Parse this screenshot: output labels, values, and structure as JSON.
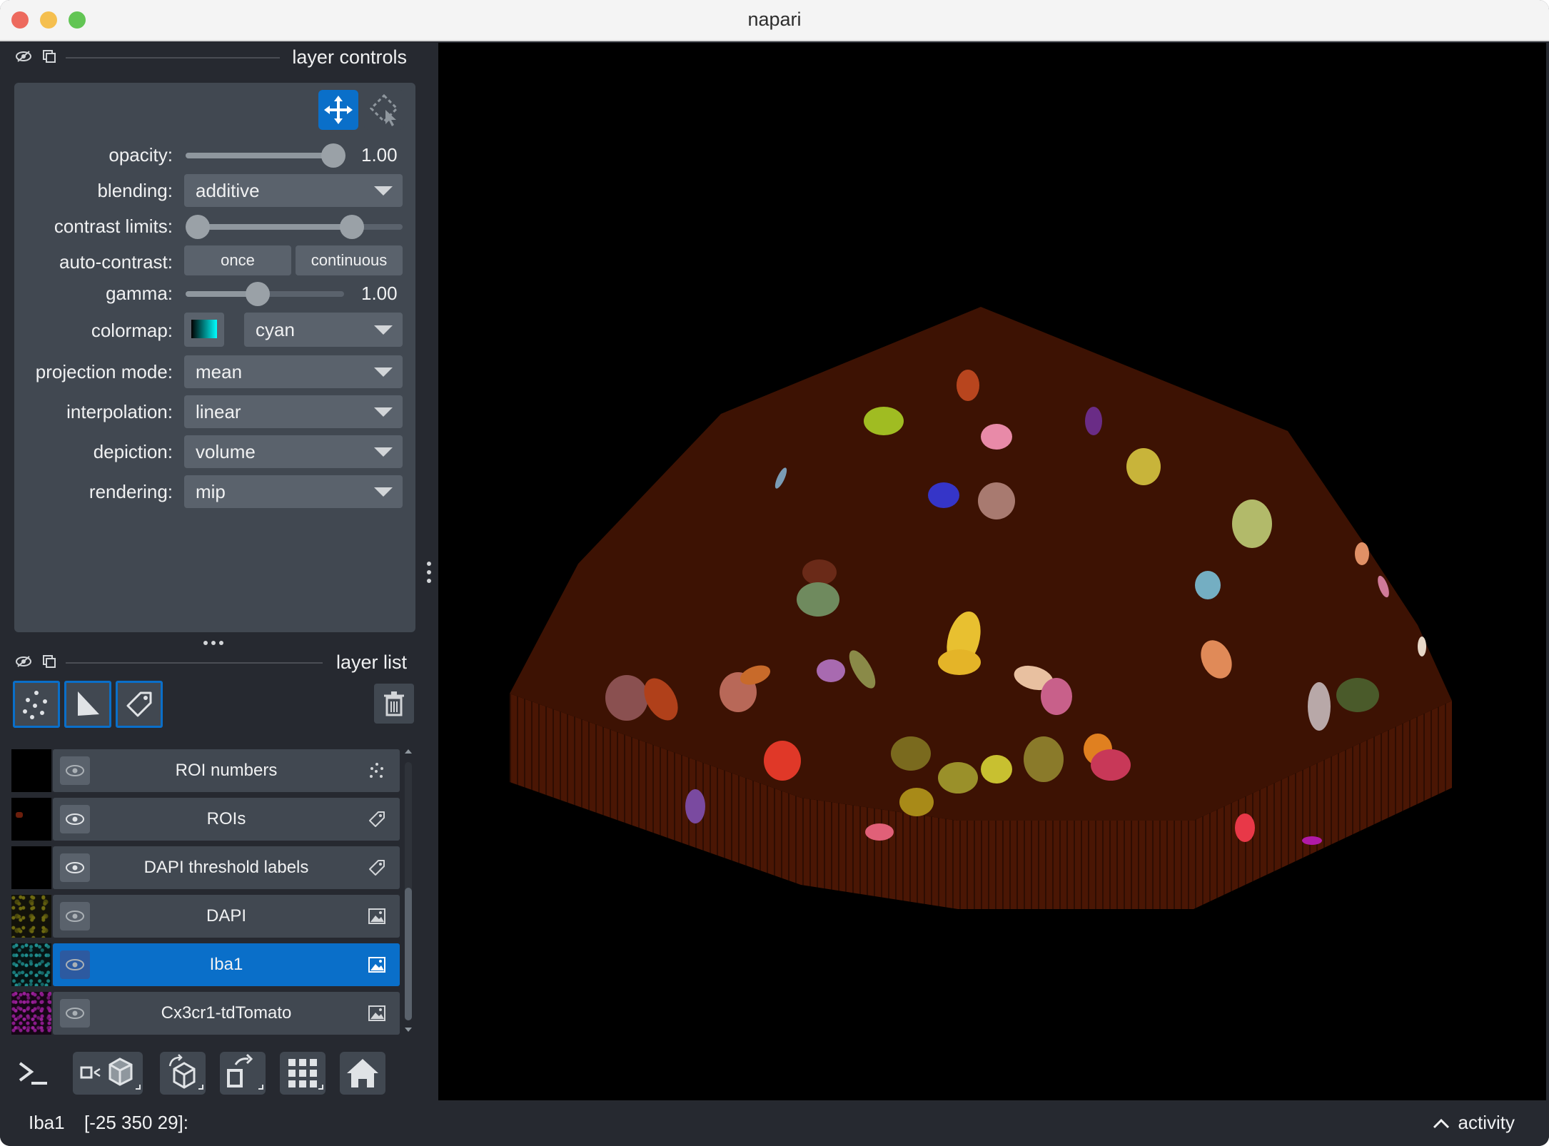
{
  "window": {
    "title": "napari",
    "traffic_lights": [
      "#ed6a5e",
      "#f5bf4f",
      "#62c554"
    ]
  },
  "layer_controls": {
    "header": "layer controls",
    "tools": [
      "pan-zoom-icon",
      "transform-icon"
    ],
    "opacity": {
      "label": "opacity:",
      "value": "1.00",
      "fraction": 1.0
    },
    "blending": {
      "label": "blending:",
      "value": "additive"
    },
    "contrast_limits": {
      "label": "contrast limits:",
      "low": 0.0,
      "high": 0.75
    },
    "auto_contrast": {
      "label": "auto-contrast:",
      "once": "once",
      "continuous": "continuous"
    },
    "gamma": {
      "label": "gamma:",
      "value": "1.00",
      "fraction": 0.45
    },
    "colormap": {
      "label": "colormap:",
      "value": "cyan"
    },
    "projection_mode": {
      "label": "projection mode:",
      "value": "mean"
    },
    "interpolation": {
      "label": "interpolation:",
      "value": "linear"
    },
    "depiction": {
      "label": "depiction:",
      "value": "volume"
    },
    "rendering": {
      "label": "rendering:",
      "value": "mip"
    }
  },
  "layer_list": {
    "header": "layer list",
    "new_layer_buttons": [
      "new-points-icon",
      "new-shapes-icon",
      "new-labels-icon"
    ],
    "layers": [
      {
        "name": "ROI numbers",
        "type_icon": "points-icon",
        "selected": false
      },
      {
        "name": "ROIs",
        "type_icon": "labels-icon",
        "selected": false
      },
      {
        "name": "DAPI threshold labels",
        "type_icon": "labels-icon",
        "selected": false
      },
      {
        "name": "DAPI",
        "type_icon": "image-icon",
        "selected": false
      },
      {
        "name": "Iba1",
        "type_icon": "image-icon",
        "selected": true
      },
      {
        "name": "Cx3cr1-tdTomato",
        "type_icon": "image-icon",
        "selected": false
      }
    ]
  },
  "viewer_buttons": [
    "console-icon",
    "ndisplay-2d-3d-icon",
    "roll-icon",
    "transpose-icon",
    "grid-icon",
    "home-icon"
  ],
  "status": {
    "layer": "Iba1",
    "coords": "[-25 350 29]:",
    "activity": "activity"
  },
  "colors": {
    "accent": "#0a6fc9",
    "panel": "#262930",
    "widget": "#414851",
    "volume": "#3d1203"
  }
}
